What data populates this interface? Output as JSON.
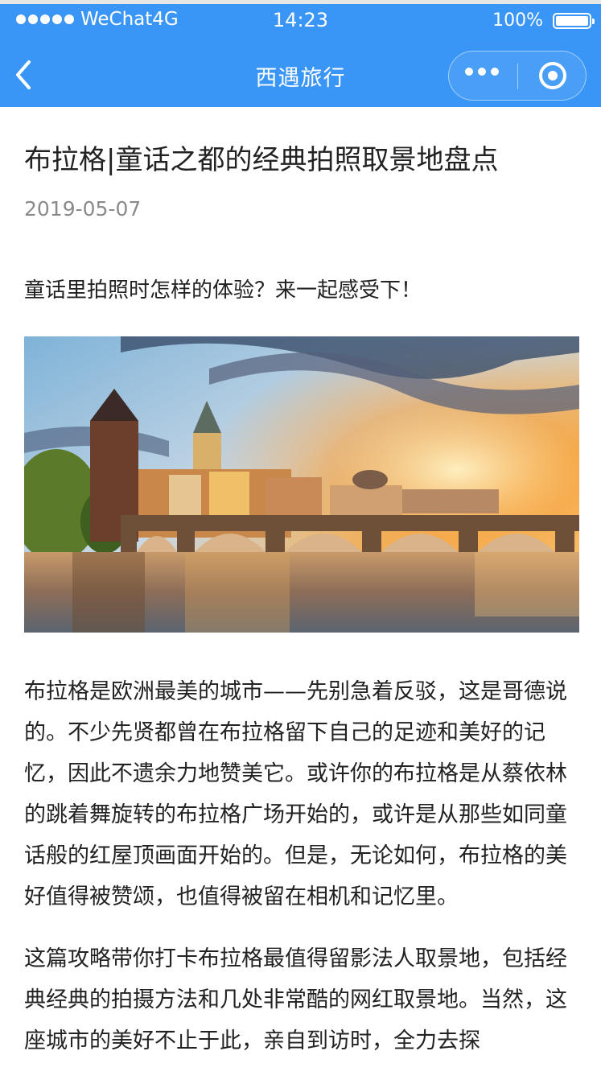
{
  "status_bar": {
    "carrier": "WeChat4G",
    "time": "14:23",
    "battery": "100%"
  },
  "nav": {
    "title": "西遇旅行",
    "back_icon": "chevron-left-icon",
    "more_icon": "more-dots-icon",
    "close_icon": "target-close-icon"
  },
  "colors": {
    "nav_bg": "#3A96F6",
    "text": "#222222",
    "date": "#8A8A8A"
  },
  "article": {
    "title": "布拉格|童话之都的经典拍照取景地盘点",
    "date": "2019-05-07",
    "lead": "童话里拍照时怎样的体验？来一起感受下！",
    "paragraph1": "布拉格是欧洲最美的城市——先别急着反驳，这是哥德说的。不少先贤都曾在布拉格留下自己的足迹和美好的记忆，因此不遗余力地赞美它。或许你的布拉格是从蔡依林的跳着舞旋转的布拉格广场开始的，或许是从那些如同童话般的红屋顶画面开始的。但是，无论如何，布拉格的美好值得被赞颂，也值得被留在相机和记忆里。",
    "paragraph2": "这篇攻略带你打卡布拉格最值得留影法人取景地，包括经典经典的拍摄方法和几处非常酷的网红取景地。当然，这座城市的美好不止于此，亲自到访时，全力去探"
  }
}
